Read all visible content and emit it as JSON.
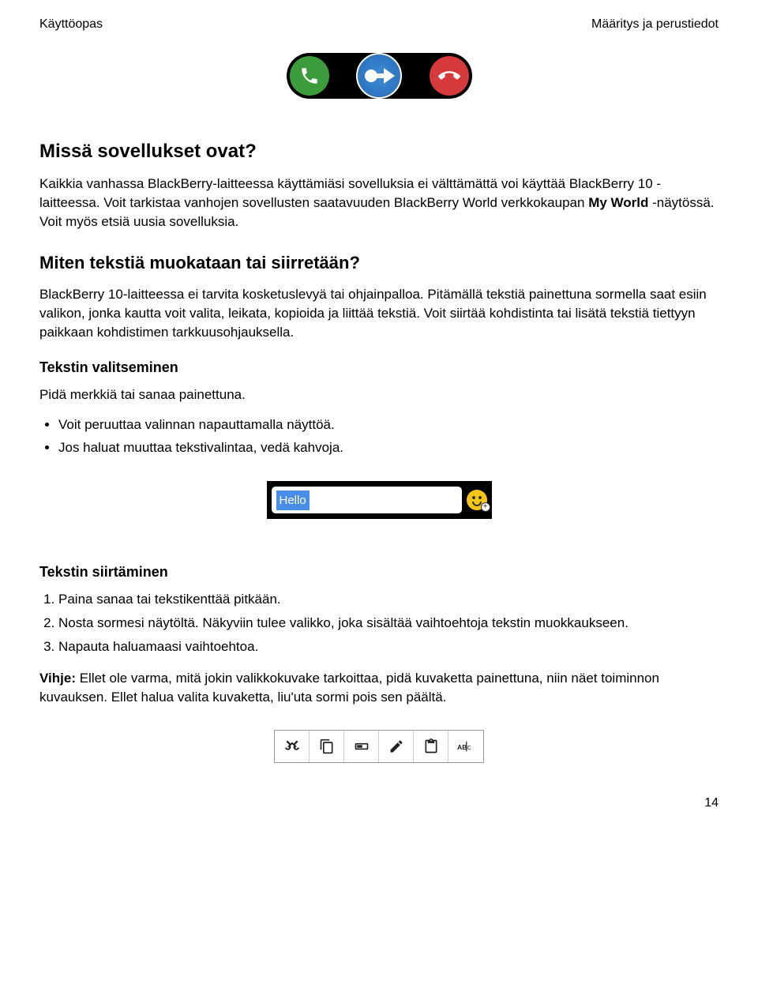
{
  "header": {
    "left": "Käyttöopas",
    "right": "Määritys ja perustiedot"
  },
  "section1": {
    "heading": "Missä sovellukset ovat?",
    "p1_a": "Kaikkia vanhassa BlackBerry-laitteessa käyttämiäsi sovelluksia ei välttämättä voi käyttää BlackBerry 10 -laitteessa. Voit tarkistaa vanhojen sovellusten saatavuuden BlackBerry World verkkokaupan ",
    "p1_bold": "My World",
    "p1_b": " -näytössä. Voit myös etsiä uusia sovelluksia."
  },
  "section2": {
    "heading": "Miten tekstiä muokataan tai siirretään?",
    "p1": "BlackBerry 10-laitteessa ei tarvita kosketuslevyä tai ohjainpalloa. Pitämällä tekstiä painettuna sormella saat esiin valikon, jonka kautta voit valita, leikata, kopioida ja liittää tekstiä. Voit siirtää kohdistinta tai lisätä tekstiä tiettyyn paikkaan kohdistimen tarkkuusohjauksella."
  },
  "section3": {
    "heading": "Tekstin valitseminen",
    "p1": "Pidä merkkiä tai sanaa painettuna.",
    "bullets": [
      "Voit peruuttaa valinnan napauttamalla näyttöä.",
      "Jos haluat muuttaa tekstivalintaa, vedä kahvoja."
    ]
  },
  "text_selection": {
    "selected": "Hello"
  },
  "section4": {
    "heading": "Tekstin siirtäminen",
    "steps": [
      "Paina sanaa tai tekstikenttää pitkään.",
      "Nosta sormesi näytöltä. Näkyviin tulee valikko, joka sisältää vaihtoehtoja tekstin muokkaukseen.",
      "Napauta haluamaasi vaihtoehtoa."
    ]
  },
  "tip": {
    "label": "Vihje:",
    "text": " Ellet ole varma, mitä jokin valikkokuvake tarkoittaa, pidä kuvaketta painettuna, niin näet toiminnon kuvauksen. Ellet halua valita kuvaketta, liu'uta sormi pois sen päältä."
  },
  "page_number": "14"
}
